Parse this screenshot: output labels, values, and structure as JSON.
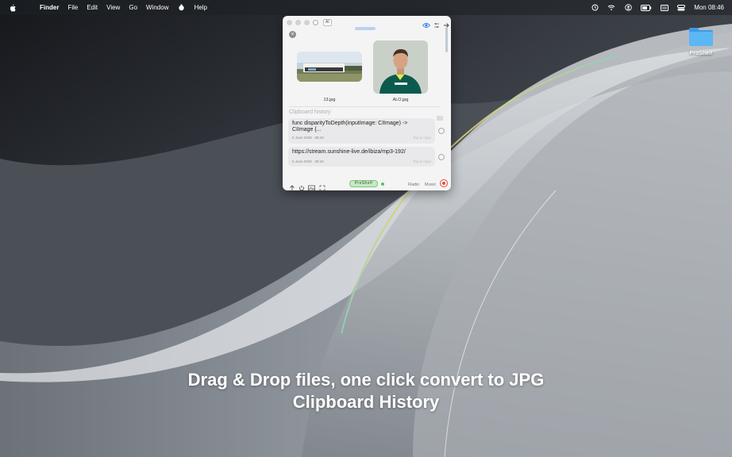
{
  "menubar": {
    "app_name": "Finder",
    "menus": [
      "File",
      "Edit",
      "View",
      "Go",
      "Window",
      "Help"
    ],
    "clock": "Mon 08:46"
  },
  "desktop": {
    "folder_label": "ProShelf"
  },
  "panel": {
    "ai_badge": "AI",
    "files": [
      {
        "name": "13.jpg"
      },
      {
        "name": "ALO.jpg"
      }
    ],
    "clipboard_title": "Clipboard history",
    "clips": [
      {
        "text": "func disparityToDepth(inputImage: CIImage) -> CIImage {...",
        "date": "6 June 2025",
        "time": "08:43",
        "hint": "Tap to copy"
      },
      {
        "text": "https://stream.sunshine-live.de/ibiza/mp3-192/",
        "date": "6 June 2025",
        "time": "08:40",
        "hint": "Tap to copy"
      }
    ],
    "footer": {
      "badge": "ProShelf",
      "radio": "Radio",
      "music": "Music"
    }
  },
  "caption": {
    "line1": "Drag & Drop files, one click convert to JPG",
    "line2": "Clipboard History"
  }
}
